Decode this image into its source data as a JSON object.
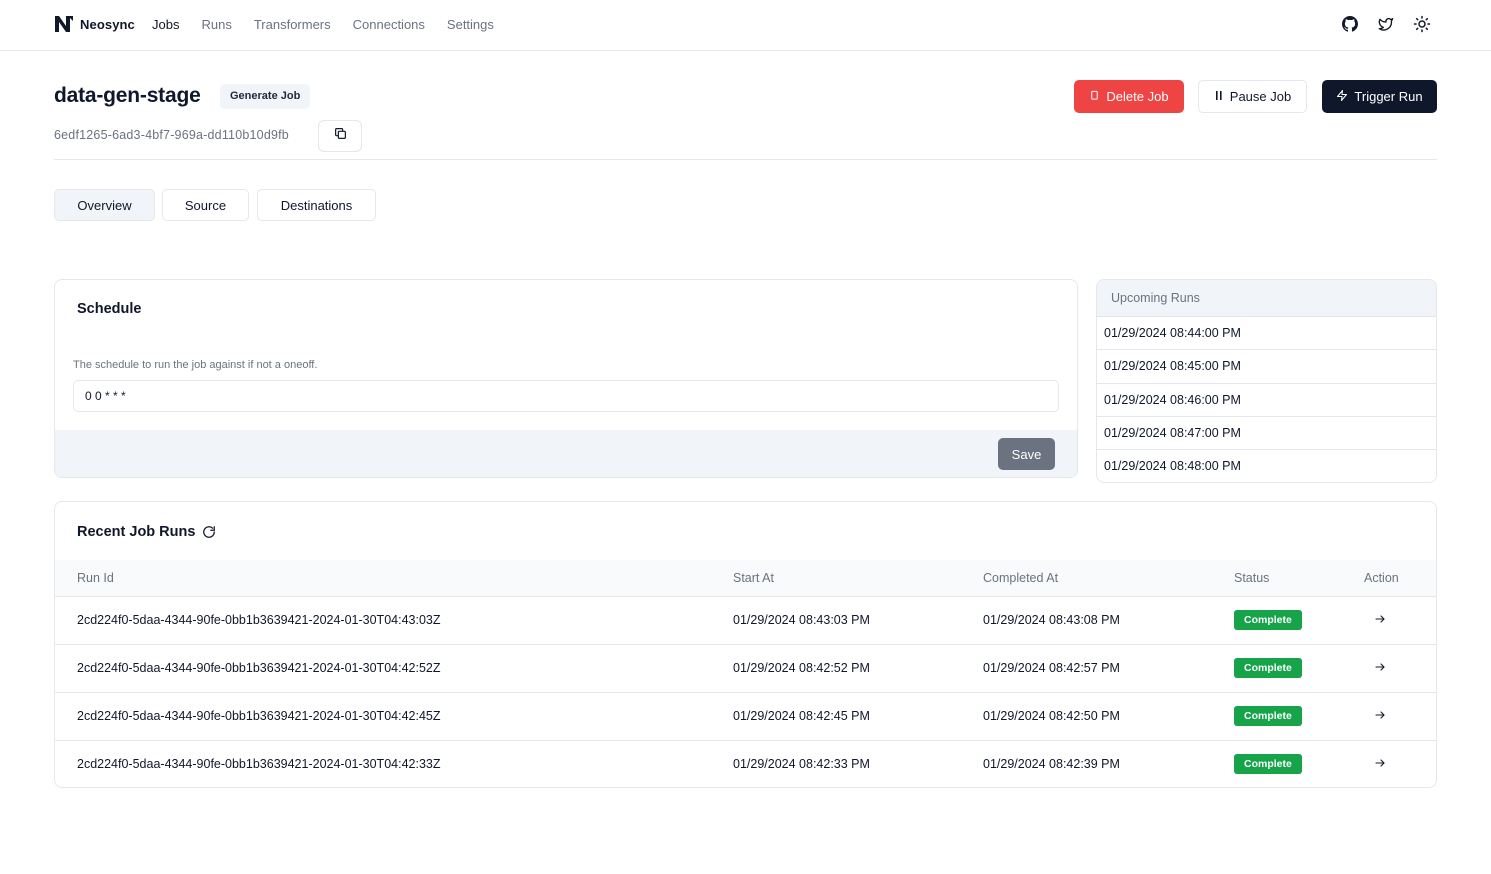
{
  "nav": {
    "brand": "Neosync",
    "links": [
      "Jobs",
      "Runs",
      "Transformers",
      "Connections",
      "Settings"
    ],
    "icons": [
      "github-icon",
      "twitter-icon",
      "sun-icon"
    ]
  },
  "header": {
    "title": "data-gen-stage",
    "type_badge": "Generate Job",
    "job_id": "6edf1265-6ad3-4bf7-969a-dd110b10d9fb",
    "delete_label": "Delete Job",
    "pause_label": "Pause Job",
    "trigger_label": "Trigger Run"
  },
  "tabs": [
    "Overview",
    "Source",
    "Destinations"
  ],
  "schedule": {
    "title": "Schedule",
    "description": "The schedule to run the job against if not a oneoff.",
    "value": "0 0 * * *",
    "save_label": "Save"
  },
  "upcoming": {
    "title": "Upcoming Runs",
    "runs": [
      "01/29/2024 08:44:00 PM",
      "01/29/2024 08:45:00 PM",
      "01/29/2024 08:46:00 PM",
      "01/29/2024 08:47:00 PM",
      "01/29/2024 08:48:00 PM"
    ]
  },
  "recent_runs": {
    "title": "Recent Job Runs",
    "columns": [
      "Run Id",
      "Start At",
      "Completed At",
      "Status",
      "Action"
    ],
    "rows": [
      {
        "id": "2cd224f0-5daa-4344-90fe-0bb1b3639421-2024-01-30T04:43:03Z",
        "start": "01/29/2024 08:43:03 PM",
        "completed": "01/29/2024 08:43:08 PM",
        "status": "Complete"
      },
      {
        "id": "2cd224f0-5daa-4344-90fe-0bb1b3639421-2024-01-30T04:42:52Z",
        "start": "01/29/2024 08:42:52 PM",
        "completed": "01/29/2024 08:42:57 PM",
        "status": "Complete"
      },
      {
        "id": "2cd224f0-5daa-4344-90fe-0bb1b3639421-2024-01-30T04:42:45Z",
        "start": "01/29/2024 08:42:45 PM",
        "completed": "01/29/2024 08:42:50 PM",
        "status": "Complete"
      },
      {
        "id": "2cd224f0-5daa-4344-90fe-0bb1b3639421-2024-01-30T04:42:33Z",
        "start": "01/29/2024 08:42:33 PM",
        "completed": "01/29/2024 08:42:39 PM",
        "status": "Complete"
      }
    ]
  },
  "colors": {
    "danger": "#ef4444",
    "primary": "#0f172a",
    "success": "#16a34a",
    "muted": "#6b7280"
  }
}
